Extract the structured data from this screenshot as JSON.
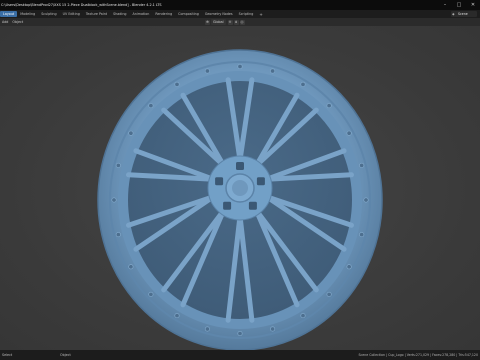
{
  "titlebar": {
    "title": "C:\\Users\\Desktop\\BlendProd27\\XXS 15 2-Piece Dualblock_withScene.blend] - Blender 4.2.1 LTS",
    "minimize": "–",
    "maximize": "□",
    "close": "✕"
  },
  "menubar": {
    "tabs": [
      "Layout",
      "Modeling",
      "Sculpting",
      "UV Editing",
      "Texture Paint",
      "Shading",
      "Animation",
      "Rendering",
      "Compositing",
      "Geometry Nodes",
      "Scripting"
    ],
    "active_tab": "Layout",
    "add_tab": "+",
    "scene_label": "Scene"
  },
  "header": {
    "items": [
      "Add",
      "Object"
    ],
    "orientation": "Global"
  },
  "statusbar": {
    "left": "Select",
    "mid": "Object",
    "right": "Scene Collection | Cup_Logo | Verts:271,029 | Faces:278,280 | Tris:547,120"
  },
  "icons": {
    "scene": "scene-icon",
    "orientation": "orientation-icon",
    "pivot": "pivot-icon",
    "snap": "snap-icon",
    "proportional": "proportional-icon"
  },
  "colors": {
    "wheel": "#6f98bd",
    "viewport": "#3d3d3d",
    "active_tab": "#3a6ea5"
  }
}
